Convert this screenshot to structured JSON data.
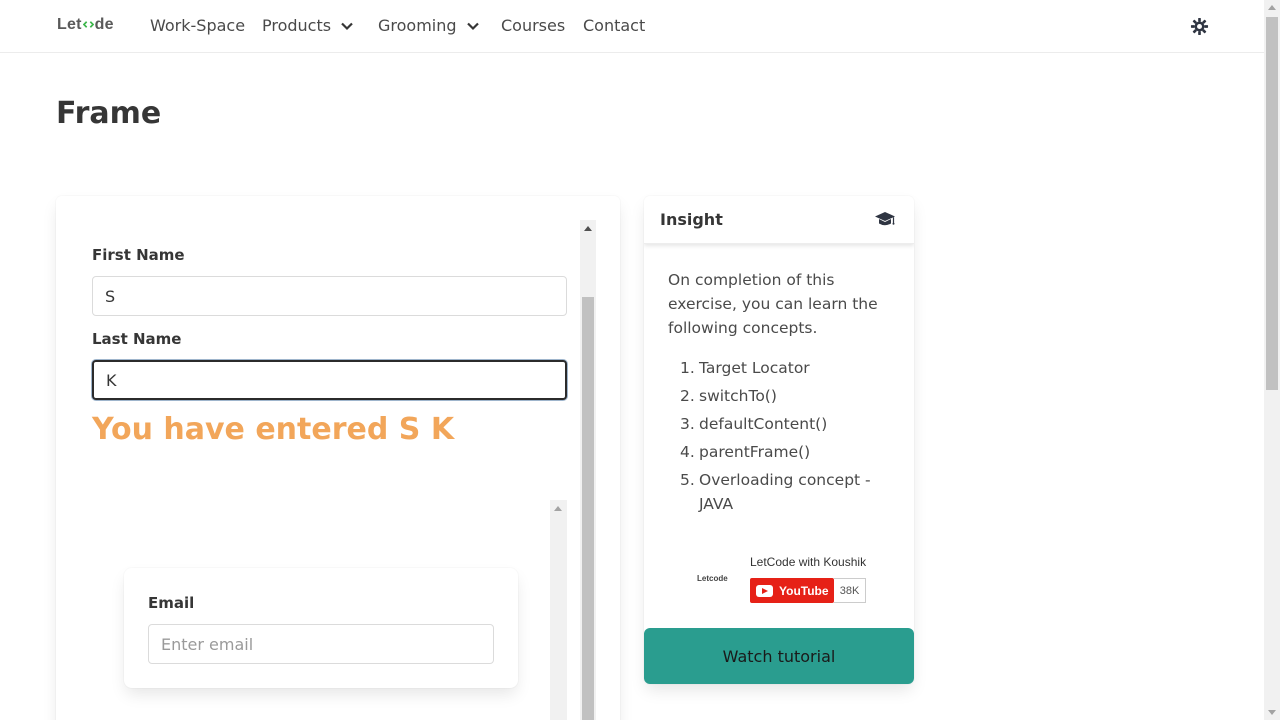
{
  "nav": {
    "logo_prefix": "Let",
    "logo_suffix": "de",
    "items": [
      {
        "label": "Work-Space",
        "has_dropdown": false
      },
      {
        "label": "Products",
        "has_dropdown": true
      },
      {
        "label": "Grooming",
        "has_dropdown": true
      },
      {
        "label": "Courses",
        "has_dropdown": false
      },
      {
        "label": "Contact",
        "has_dropdown": false
      }
    ],
    "theme_icon": "gear-icon"
  },
  "page": {
    "title": "Frame"
  },
  "frame": {
    "first_name_label": "First Name",
    "first_name_value": "S",
    "last_name_label": "Last Name",
    "last_name_value": "K",
    "entered_text": "You have entered S K",
    "email_label": "Email",
    "email_placeholder": "Enter email"
  },
  "insight": {
    "title": "Insight",
    "icon": "graduation-cap-icon",
    "description": "On completion of this exercise, you can learn the following concepts.",
    "concepts": [
      {
        "num": "1.",
        "text": "Target Locator"
      },
      {
        "num": "2.",
        "text": "switchTo()"
      },
      {
        "num": "3.",
        "text": "defaultContent()"
      },
      {
        "num": "4.",
        "text": "parentFrame()"
      },
      {
        "num": "5.",
        "text": "Overloading concept - JAVA"
      }
    ],
    "youtube": {
      "logo_text": "Letcode",
      "channel": "LetCode with Koushik",
      "button_label": "YouTube",
      "subscriber_count": "38K"
    },
    "watch_button": "Watch tutorial"
  },
  "colors": {
    "accent_teal": "#2a9d8f",
    "entered_orange": "#f2a65a",
    "logo_green": "#3bb54a",
    "youtube_red": "#e62117"
  }
}
